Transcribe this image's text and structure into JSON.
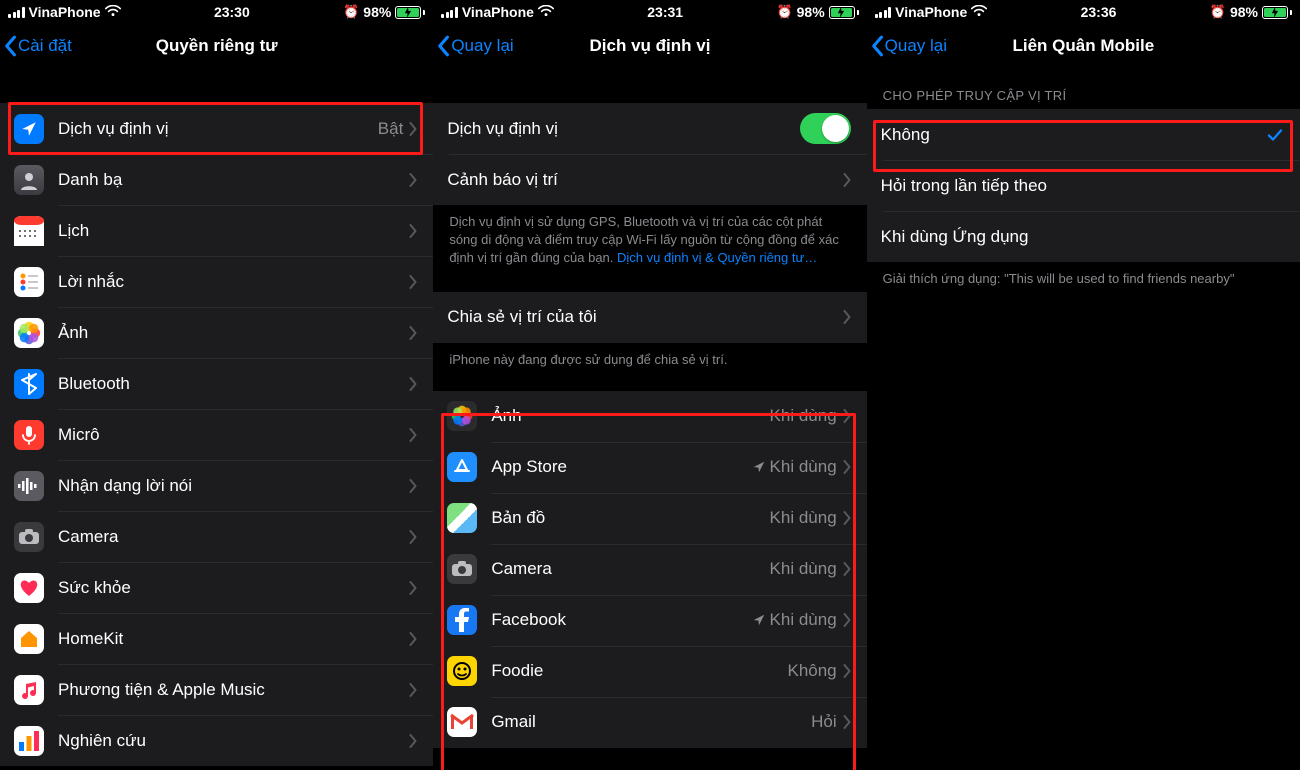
{
  "statusbar": {
    "carrier": "VinaPhone",
    "batt_pct": "98%"
  },
  "screen1": {
    "time": "23:30",
    "back": "Cài đặt",
    "title": "Quyền riêng tư",
    "rows": [
      {
        "label": "Dịch vụ định vị",
        "value": "Bật"
      },
      {
        "label": "Danh bạ"
      },
      {
        "label": "Lịch"
      },
      {
        "label": "Lời nhắc"
      },
      {
        "label": "Ảnh"
      },
      {
        "label": "Bluetooth"
      },
      {
        "label": "Micrô"
      },
      {
        "label": "Nhận dạng lời nói"
      },
      {
        "label": "Camera"
      },
      {
        "label": "Sức khỏe"
      },
      {
        "label": "HomeKit"
      },
      {
        "label": "Phương tiện & Apple Music"
      },
      {
        "label": "Nghiên cứu"
      }
    ]
  },
  "screen2": {
    "time": "23:31",
    "back": "Quay lại",
    "title": "Dịch vụ định vị",
    "toggle_label": "Dịch vụ định vị",
    "alerts_label": "Cảnh báo vị trí",
    "desc_a": "Dịch vụ định vị sử dụng GPS, Bluetooth và vị trí của các cột phát sóng di động và điểm truy cập Wi-Fi lấy nguồn từ cộng đồng để xác định vị trí gần đúng của bạn. ",
    "desc_link": "Dịch vụ định vị & Quyền riêng tư…",
    "share_label": "Chia sẻ vị trí của tôi",
    "share_note": "iPhone này đang được sử dụng để chia sẻ vị trí.",
    "apps": [
      {
        "label": "Ảnh",
        "value": "Khi dùng",
        "arrow": false
      },
      {
        "label": "App Store",
        "value": "Khi dùng",
        "arrow": true
      },
      {
        "label": "Bản đồ",
        "value": "Khi dùng",
        "arrow": false
      },
      {
        "label": "Camera",
        "value": "Khi dùng",
        "arrow": false
      },
      {
        "label": "Facebook",
        "value": "Khi dùng",
        "arrow": true
      },
      {
        "label": "Foodie",
        "value": "Không",
        "arrow": false
      },
      {
        "label": "Gmail",
        "value": "Hỏi",
        "arrow": false
      }
    ]
  },
  "screen3": {
    "time": "23:36",
    "back": "Quay lại",
    "title": "Liên Quân Mobile",
    "section": "CHO PHÉP TRUY CẬP VỊ TRÍ",
    "options": [
      {
        "label": "Không",
        "selected": true
      },
      {
        "label": "Hỏi trong lần tiếp theo",
        "selected": false
      },
      {
        "label": "Khi dùng Ứng dụng",
        "selected": false
      }
    ],
    "explain": "Giải thích ứng dụng: \"This will be used to find friends nearby\""
  }
}
